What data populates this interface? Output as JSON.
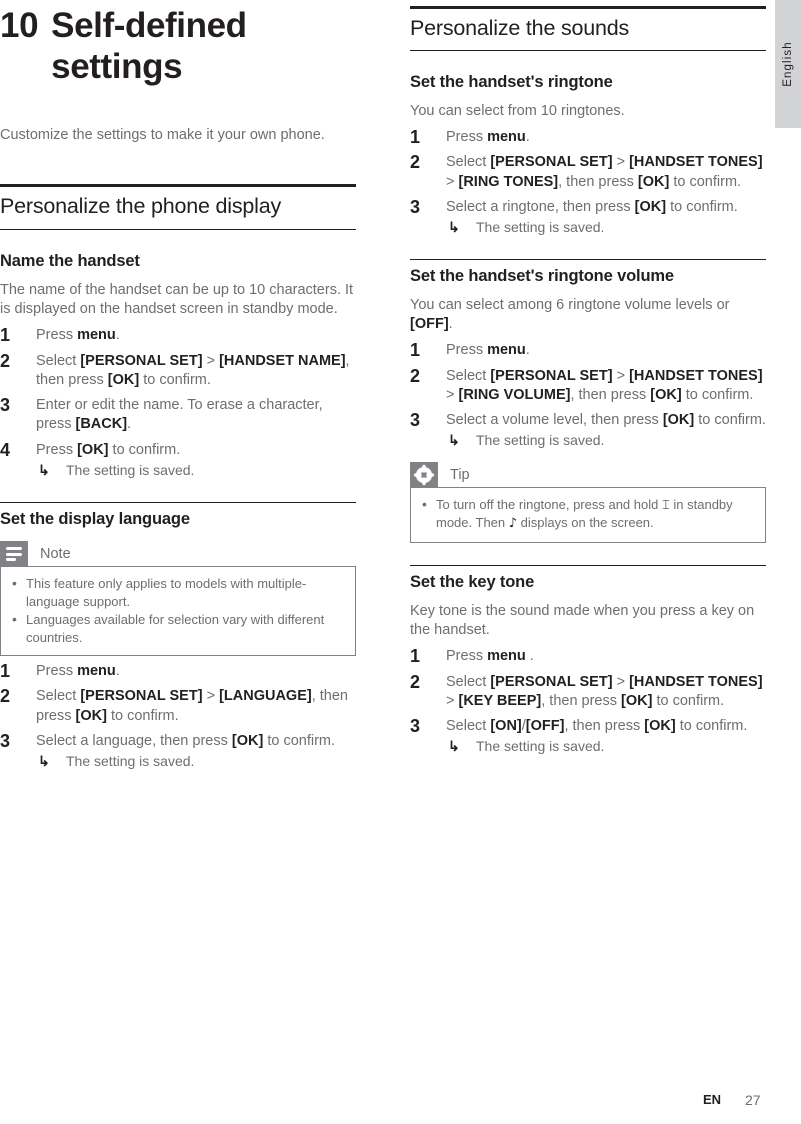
{
  "page": {
    "language_tab": "English",
    "footer_language": "EN",
    "footer_page_number": "27",
    "accent_black": "#231f20",
    "body_gray": "#6d6e71",
    "callout_gray": "#808285",
    "tab_gray": "#d1d3d4"
  },
  "chapter": {
    "number": "10",
    "title": "Self-defined settings",
    "intro": "Customize the settings to make it your own phone."
  },
  "left_column": {
    "section": {
      "title": "Personalize the phone display",
      "subsections": [
        {
          "title": "Name the handset",
          "intro": "The name of the handset can be up to 10 characters. It is displayed on the handset screen in standby mode.",
          "steps": [
            {
              "num": "1",
              "parts": [
                {
                  "t": "Press ",
                  "b": false
                },
                {
                  "t": "menu",
                  "b": true
                },
                {
                  "t": ".",
                  "b": false
                }
              ]
            },
            {
              "num": "2",
              "parts": [
                {
                  "t": "Select ",
                  "b": false
                },
                {
                  "t": "[PERSONAL SET]",
                  "b": true
                },
                {
                  "t": " > ",
                  "b": false
                },
                {
                  "t": "[HANDSET NAME]",
                  "b": true
                },
                {
                  "t": ", then press ",
                  "b": false
                },
                {
                  "t": "[OK]",
                  "b": true
                },
                {
                  "t": " to confirm.",
                  "b": false
                }
              ]
            },
            {
              "num": "3",
              "parts": [
                {
                  "t": "Enter or edit the name. To erase a character, press ",
                  "b": false
                },
                {
                  "t": "[BACK]",
                  "b": true
                },
                {
                  "t": ".",
                  "b": false
                }
              ]
            },
            {
              "num": "4",
              "parts": [
                {
                  "t": "Press ",
                  "b": false
                },
                {
                  "t": "[OK]",
                  "b": true
                },
                {
                  "t": " to confirm.",
                  "b": false
                }
              ],
              "result": "The setting is saved."
            }
          ]
        },
        {
          "title": "Set the display language",
          "callout": {
            "type": "note",
            "icon": "lines-icon",
            "label": "Note",
            "bullets": [
              "This feature only applies to models with multiple-language support.",
              "Languages available for selection vary with different countries."
            ]
          },
          "steps": [
            {
              "num": "1",
              "parts": [
                {
                  "t": "Press ",
                  "b": false
                },
                {
                  "t": "menu",
                  "b": true
                },
                {
                  "t": ".",
                  "b": false
                }
              ]
            },
            {
              "num": "2",
              "parts": [
                {
                  "t": "Select ",
                  "b": false
                },
                {
                  "t": "[PERSONAL SET]",
                  "b": true
                },
                {
                  "t": " > ",
                  "b": false
                },
                {
                  "t": "[LANGUAGE]",
                  "b": true
                },
                {
                  "t": ", then press ",
                  "b": false
                },
                {
                  "t": "[OK]",
                  "b": true
                },
                {
                  "t": " to confirm.",
                  "b": false
                }
              ]
            },
            {
              "num": "3",
              "parts": [
                {
                  "t": "Select a language, then press ",
                  "b": false
                },
                {
                  "t": "[OK]",
                  "b": true
                },
                {
                  "t": " to confirm.",
                  "b": false
                }
              ],
              "result": "The setting is saved."
            }
          ]
        }
      ]
    }
  },
  "right_column": {
    "section": {
      "title": "Personalize the sounds",
      "subsections": [
        {
          "title": "Set the handset's ringtone",
          "intro": "You can select from 10 ringtones.",
          "steps": [
            {
              "num": "1",
              "parts": [
                {
                  "t": "Press ",
                  "b": false
                },
                {
                  "t": "menu",
                  "b": true
                },
                {
                  "t": ".",
                  "b": false
                }
              ]
            },
            {
              "num": "2",
              "parts": [
                {
                  "t": "Select ",
                  "b": false
                },
                {
                  "t": "[PERSONAL SET]",
                  "b": true
                },
                {
                  "t": " > ",
                  "b": false
                },
                {
                  "t": "[HANDSET TONES]",
                  "b": true
                },
                {
                  "t": " > ",
                  "b": false
                },
                {
                  "t": "[RING TONES]",
                  "b": true
                },
                {
                  "t": ", then press ",
                  "b": false
                },
                {
                  "t": "[OK]",
                  "b": true
                },
                {
                  "t": " to confirm.",
                  "b": false
                }
              ]
            },
            {
              "num": "3",
              "parts": [
                {
                  "t": "Select a ringtone, then press ",
                  "b": false
                },
                {
                  "t": "[OK]",
                  "b": true
                },
                {
                  "t": " to confirm.",
                  "b": false
                }
              ],
              "result": "The setting is saved."
            }
          ]
        },
        {
          "title": "Set the handset's ringtone volume",
          "intro_parts": [
            {
              "t": "You can select among 6 ringtone volume levels or ",
              "b": false
            },
            {
              "t": "[OFF]",
              "b": true
            },
            {
              "t": ".",
              "b": false
            }
          ],
          "steps": [
            {
              "num": "1",
              "parts": [
                {
                  "t": "Press ",
                  "b": false
                },
                {
                  "t": "menu",
                  "b": true
                },
                {
                  "t": ".",
                  "b": false
                }
              ]
            },
            {
              "num": "2",
              "parts": [
                {
                  "t": "Select ",
                  "b": false
                },
                {
                  "t": "[PERSONAL SET]",
                  "b": true
                },
                {
                  "t": " > ",
                  "b": false
                },
                {
                  "t": "[HANDSET TONES]",
                  "b": true
                },
                {
                  "t": " > ",
                  "b": false
                },
                {
                  "t": "[RING VOLUME]",
                  "b": true
                },
                {
                  "t": ", then press ",
                  "b": false
                },
                {
                  "t": "[OK]",
                  "b": true
                },
                {
                  "t": " to confirm.",
                  "b": false
                }
              ]
            },
            {
              "num": "3",
              "parts": [
                {
                  "t": "Select a volume level, then press ",
                  "b": false
                },
                {
                  "t": "[OK]",
                  "b": true
                },
                {
                  "t": " to confirm.",
                  "b": false
                }
              ],
              "result": "The setting is saved."
            }
          ],
          "callout": {
            "type": "tip",
            "icon": "asterisk-icon",
            "label": "Tip",
            "bullet_parts": [
              {
                "t": "To turn off the ringtone, press and hold ",
                "g": null
              },
              {
                "t": "",
                "g": "key"
              },
              {
                "t": " in standby mode. Then ",
                "g": null
              },
              {
                "t": "",
                "g": "mute"
              },
              {
                "t": " displays on the screen.",
                "g": null
              }
            ]
          }
        },
        {
          "title": "Set the key tone",
          "intro": "Key tone is the sound made when you press a key on the handset.",
          "steps": [
            {
              "num": "1",
              "parts": [
                {
                  "t": "Press ",
                  "b": false
                },
                {
                  "t": "menu",
                  "b": true
                },
                {
                  "t": " .",
                  "b": false
                }
              ]
            },
            {
              "num": "2",
              "parts": [
                {
                  "t": "Select ",
                  "b": false
                },
                {
                  "t": "[PERSONAL SET]",
                  "b": true
                },
                {
                  "t": " > ",
                  "b": false
                },
                {
                  "t": "[HANDSET TONES]",
                  "b": true
                },
                {
                  "t": " > ",
                  "b": false
                },
                {
                  "t": "[KEY BEEP]",
                  "b": true
                },
                {
                  "t": ", then press ",
                  "b": false
                },
                {
                  "t": "[OK]",
                  "b": true
                },
                {
                  "t": " to confirm.",
                  "b": false
                }
              ]
            },
            {
              "num": "3",
              "parts": [
                {
                  "t": "Select ",
                  "b": false
                },
                {
                  "t": "[ON]",
                  "b": true
                },
                {
                  "t": "/",
                  "b": false
                },
                {
                  "t": "[OFF]",
                  "b": true
                },
                {
                  "t": ", then press ",
                  "b": false
                },
                {
                  "t": "[OK]",
                  "b": true
                },
                {
                  "t": " to confirm.",
                  "b": false
                }
              ],
              "result": "The setting is saved."
            }
          ]
        }
      ]
    }
  },
  "icons": {
    "arrow_result": "↳",
    "bullet_dot": "•",
    "key_glyph": "⌶",
    "mute_glyph": "♪"
  }
}
